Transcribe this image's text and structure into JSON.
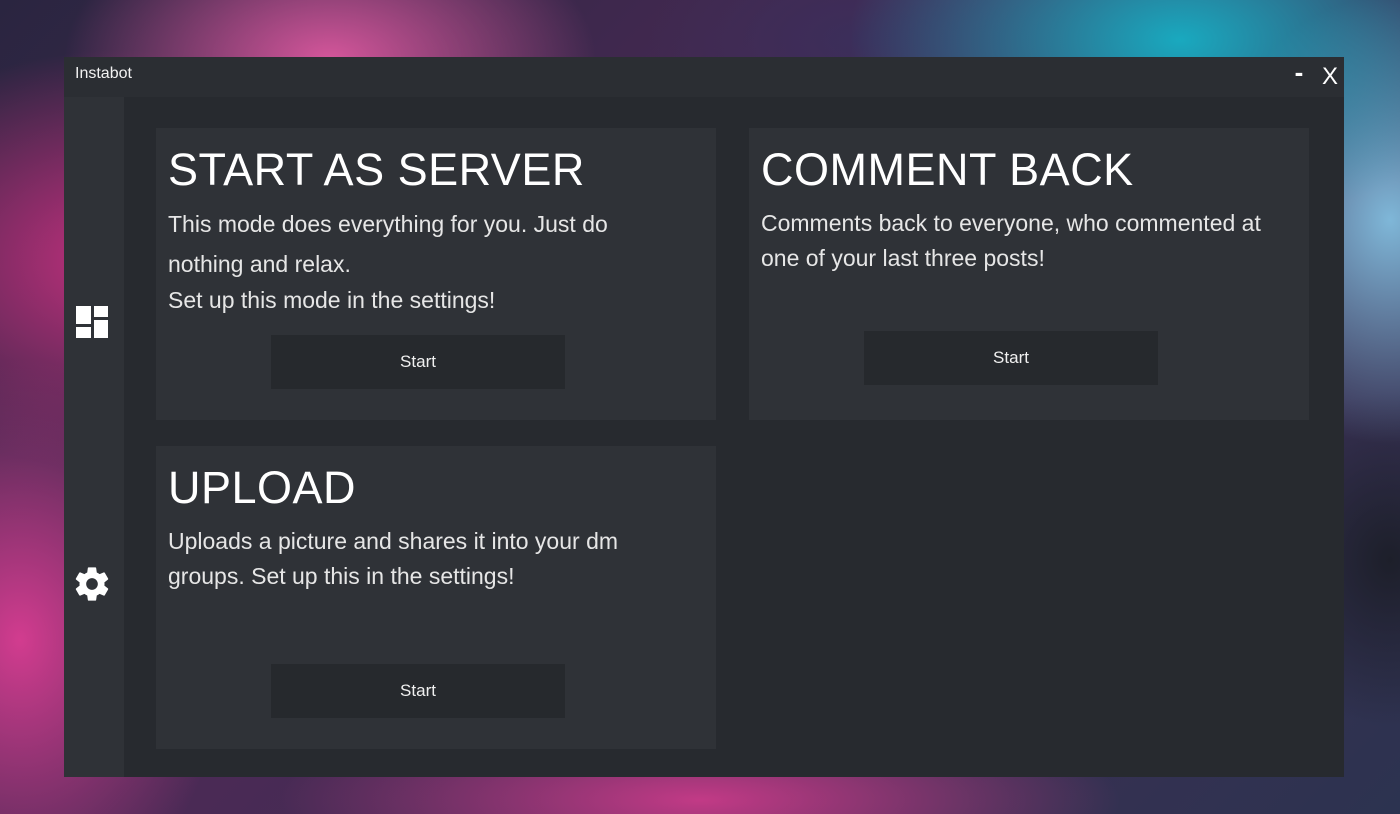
{
  "window": {
    "title": "Instabot",
    "minimize_label": "-",
    "close_label": "X"
  },
  "sidebar": {
    "items": [
      {
        "name": "dashboard",
        "icon": "dashboard-icon"
      },
      {
        "name": "settings",
        "icon": "gear-icon"
      }
    ]
  },
  "cards": {
    "server": {
      "title": "START AS SERVER",
      "desc_line1": "This mode does everything for you. Just do nothing and relax.",
      "desc_line2": "Set up this mode in the settings!",
      "button": "Start"
    },
    "comment": {
      "title": "COMMENT BACK",
      "desc": "Comments back to everyone, who commented at one of your last three posts!",
      "button": "Start"
    },
    "upload": {
      "title": "UPLOAD",
      "desc": "Uploads a picture and shares it into your dm groups. Set up this in the settings!",
      "button": "Start"
    }
  },
  "colors": {
    "window_bg": "#272a2f",
    "panel_bg": "#2f3237",
    "button_bg": "#26292d",
    "text": "#ffffff"
  }
}
